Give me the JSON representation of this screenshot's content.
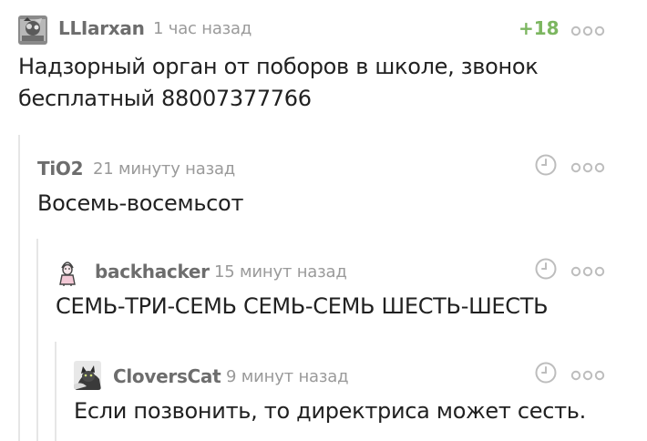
{
  "comments": [
    {
      "author": "LLIarxan",
      "time": "1 час назад",
      "rating": "+18",
      "text_line1": "Надзорный орган от поборов в школе, звонок",
      "text_line2": "бесплатный 88007377766",
      "avatar_icon": "avatar-image",
      "more_icon": "more-options-icon"
    },
    {
      "author": "TiO2",
      "time": "21 минуту назад",
      "text": "Восемь-восемьсот",
      "status_icon": "clock-icon",
      "more_icon": "more-options-icon"
    },
    {
      "author": "backhacker",
      "time": "15 минут назад",
      "text": "СЕМЬ-ТРИ-СЕМЬ СЕМЬ-СЕМЬ ШЕСТЬ-ШЕСТЬ",
      "avatar_icon": "avatar-figure",
      "status_icon": "clock-icon",
      "more_icon": "more-options-icon"
    },
    {
      "author": "CloversCat",
      "time": "9 минут назад",
      "text": "Если позвонить, то директриса может сесть.",
      "avatar_icon": "avatar-cat",
      "status_icon": "clock-icon",
      "more_icon": "more-options-icon"
    }
  ],
  "colors": {
    "rating_positive": "#7cb660",
    "author": "#6d6d6d",
    "meta": "#9a9a9a",
    "thread_line": "#e6e6e6",
    "icon": "#bdbdbd",
    "text": "#212121"
  }
}
